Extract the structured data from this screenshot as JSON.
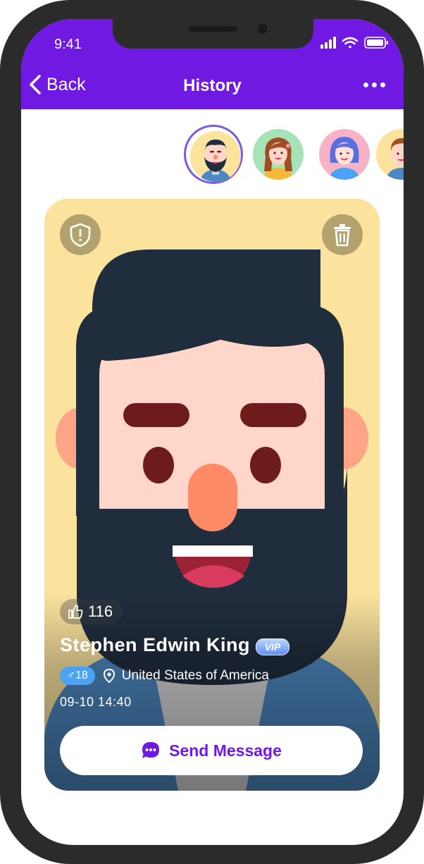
{
  "status_bar": {
    "time": "9:41"
  },
  "nav": {
    "back_label": "Back",
    "title": "History"
  },
  "avatars": [
    {
      "icon": "bearded-man-avatar",
      "selected": true
    },
    {
      "icon": "woman-brown-hair-avatar",
      "selected": false
    },
    {
      "icon": "woman-blue-hair-avatar",
      "selected": false
    },
    {
      "icon": "man-short-hair-avatar",
      "selected": false
    }
  ],
  "profile": {
    "likes": "116",
    "name": "Stephen Edwin King",
    "badge": "VIP",
    "gender_age": "♂18",
    "location": "United States of America",
    "timestamp": "09-10 14:40"
  },
  "actions": {
    "send_message_label": "Send Message"
  },
  "colors": {
    "accent": "#7019e2",
    "card_bg": "#fbe39e",
    "gender_badge": "#4aa3f5"
  }
}
